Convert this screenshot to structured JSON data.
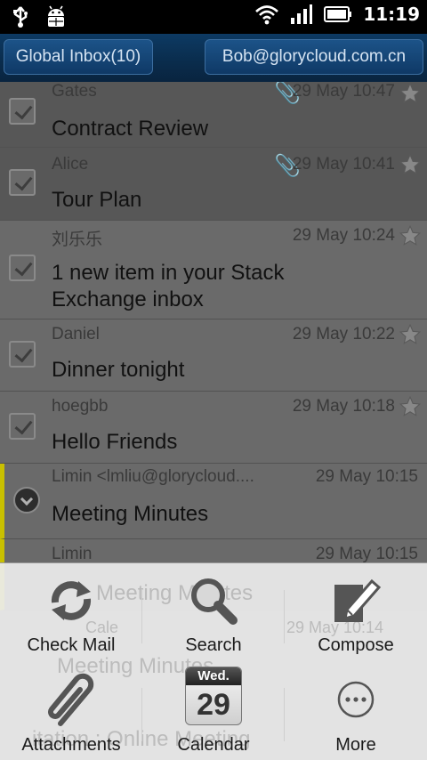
{
  "status_bar": {
    "time": "11:19",
    "icons": [
      "usb-icon",
      "android-debug-icon",
      "wifi-icon",
      "signal-icon",
      "battery-icon"
    ]
  },
  "header": {
    "inbox_label": "Global Inbox(10)",
    "account_label": "Bob@glorycloud.com.cn"
  },
  "emails": [
    {
      "sender": "Gates",
      "subject": "Contract Review",
      "date": "29 May 10:47",
      "attachment": true,
      "starred": false
    },
    {
      "sender": "Alice",
      "subject": "Tour Plan",
      "date": "29 May 10:41",
      "attachment": true,
      "starred": false
    },
    {
      "sender": "刘乐乐",
      "subject": "1 new item in your Stack Exchange inbox",
      "date": "29 May 10:24",
      "attachment": false,
      "starred": false
    },
    {
      "sender": "Daniel",
      "subject": "Dinner tonight",
      "date": "29 May 10:22",
      "attachment": false,
      "starred": false
    },
    {
      "sender": "hoegbb",
      "subject": "Hello Friends",
      "date": "29 May 10:18",
      "attachment": false,
      "starred": false
    },
    {
      "sender": "Limin <lmliu@glorycloud....",
      "subject": "Meeting Minutes",
      "date": "29 May 10:15",
      "attachment": false,
      "starred": false,
      "expandable": true
    },
    {
      "sender": "Limin",
      "subject": "Meeting Minutes",
      "date": "29 May 10:15"
    }
  ],
  "ghost_text": {
    "row8_subject": "Meeting Minutes",
    "row9_sender": "Cale",
    "row9_date": "29 May 10:14",
    "row9_subject": "Meeting Minutes",
    "row10_subject": "itation : Online Meeting"
  },
  "menu": {
    "items": [
      {
        "label": "Check Mail",
        "icon": "refresh-icon"
      },
      {
        "label": "Search",
        "icon": "magnifier-icon"
      },
      {
        "label": "Compose",
        "icon": "compose-icon"
      },
      {
        "label": "Attachments",
        "icon": "paperclip-icon"
      },
      {
        "label": "Calendar",
        "icon": "calendar-icon",
        "day_name": "Wed.",
        "day_number": "29"
      },
      {
        "label": "More",
        "icon": "more-icon"
      }
    ]
  },
  "colors": {
    "header_blue": "#0a2c4c",
    "selected_marker": "#c9c000",
    "menu_bg": "#ececec"
  }
}
